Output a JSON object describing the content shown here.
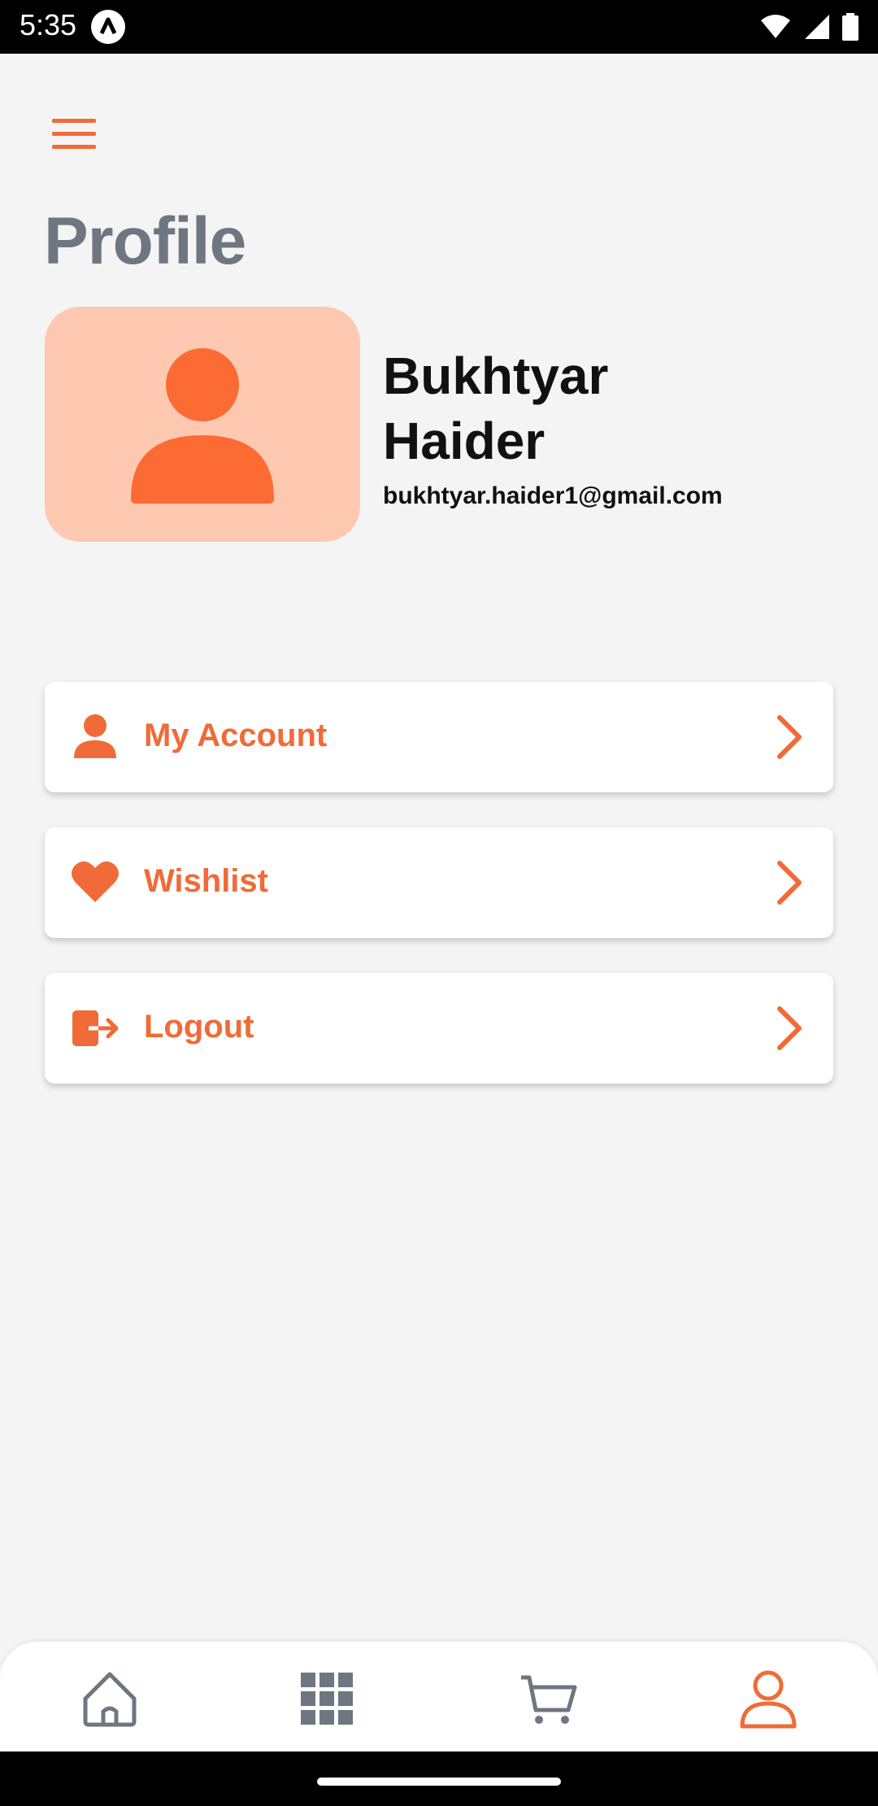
{
  "status_bar": {
    "time": "5:35",
    "icons": [
      "app-notification-icon",
      "wifi-icon",
      "signal-icon",
      "battery-icon"
    ]
  },
  "header": {
    "menu_icon": "hamburger-menu-icon",
    "title": "Profile"
  },
  "profile": {
    "avatar_icon": "user-avatar-icon",
    "first_name": "Bukhtyar",
    "last_name": "Haider",
    "email": "bukhtyar.haider1@gmail.com"
  },
  "menu": [
    {
      "label": "My Account",
      "icon": "person-icon"
    },
    {
      "label": "Wishlist",
      "icon": "heart-icon"
    },
    {
      "label": "Logout",
      "icon": "logout-icon"
    }
  ],
  "bottom_nav": {
    "items": [
      {
        "icon": "home-icon",
        "active": false
      },
      {
        "icon": "grid-icon",
        "active": false
      },
      {
        "icon": "cart-icon",
        "active": false
      },
      {
        "icon": "profile-icon",
        "active": true
      }
    ]
  },
  "colors": {
    "accent": "#f06b38",
    "avatar_bg": "#ffc8b1",
    "title_gray": "#6e7681",
    "background": "#f4f4f4",
    "nav_inactive": "#6e7681"
  }
}
